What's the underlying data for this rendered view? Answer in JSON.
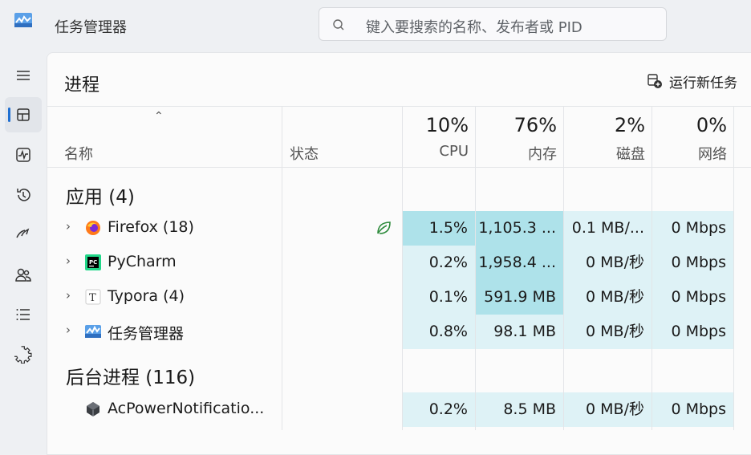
{
  "app": {
    "title": "任务管理器"
  },
  "search": {
    "placeholder": "键入要搜索的名称、发布者或 PID"
  },
  "sidebar": {
    "items": [
      {
        "icon": "hamburger-menu-icon"
      },
      {
        "icon": "processes-icon",
        "active": true
      },
      {
        "icon": "performance-icon"
      },
      {
        "icon": "app-history-icon"
      },
      {
        "icon": "startup-apps-icon"
      },
      {
        "icon": "users-icon"
      },
      {
        "icon": "details-icon"
      },
      {
        "icon": "services-icon"
      }
    ]
  },
  "page": {
    "title": "进程",
    "run_task_label": "运行新任务"
  },
  "columns": {
    "name": "名称",
    "status": "状态",
    "cpu": {
      "pct": "10%",
      "label": "CPU"
    },
    "memory": {
      "pct": "76%",
      "label": "内存"
    },
    "disk": {
      "pct": "2%",
      "label": "磁盘"
    },
    "network": {
      "pct": "0%",
      "label": "网络"
    }
  },
  "groups": {
    "apps": "应用 (4)",
    "background": "后台进程 (116)"
  },
  "rows": [
    {
      "name": "Firefox (18)",
      "icon": "firefox-icon",
      "cpu": "1.5%",
      "memory": "1,105.3 ...",
      "disk": "0.1 MB/...",
      "network": "0 Mbps",
      "eco": true
    },
    {
      "name": "PyCharm",
      "icon": "pycharm-icon",
      "cpu": "0.2%",
      "memory": "1,958.4 ...",
      "disk": "0 MB/秒",
      "network": "0 Mbps"
    },
    {
      "name": "Typora (4)",
      "icon": "typora-icon",
      "cpu": "0.1%",
      "memory": "591.9 MB",
      "disk": "0 MB/秒",
      "network": "0 Mbps"
    },
    {
      "name": "任务管理器",
      "icon": "task-manager-icon",
      "cpu": "0.8%",
      "memory": "98.1 MB",
      "disk": "0 MB/秒",
      "network": "0 Mbps"
    },
    {
      "name": "AcPowerNotificatio...",
      "icon": "acpower-icon",
      "cpu": "0.2%",
      "memory": "8.5 MB",
      "disk": "0 MB/秒",
      "network": "0 Mbps"
    }
  ],
  "colors": {
    "heat_low": "#def2f6",
    "heat_mid": "#c6ebf2",
    "heat_high": "#aee2ea",
    "accent": "#1f6fd1"
  }
}
